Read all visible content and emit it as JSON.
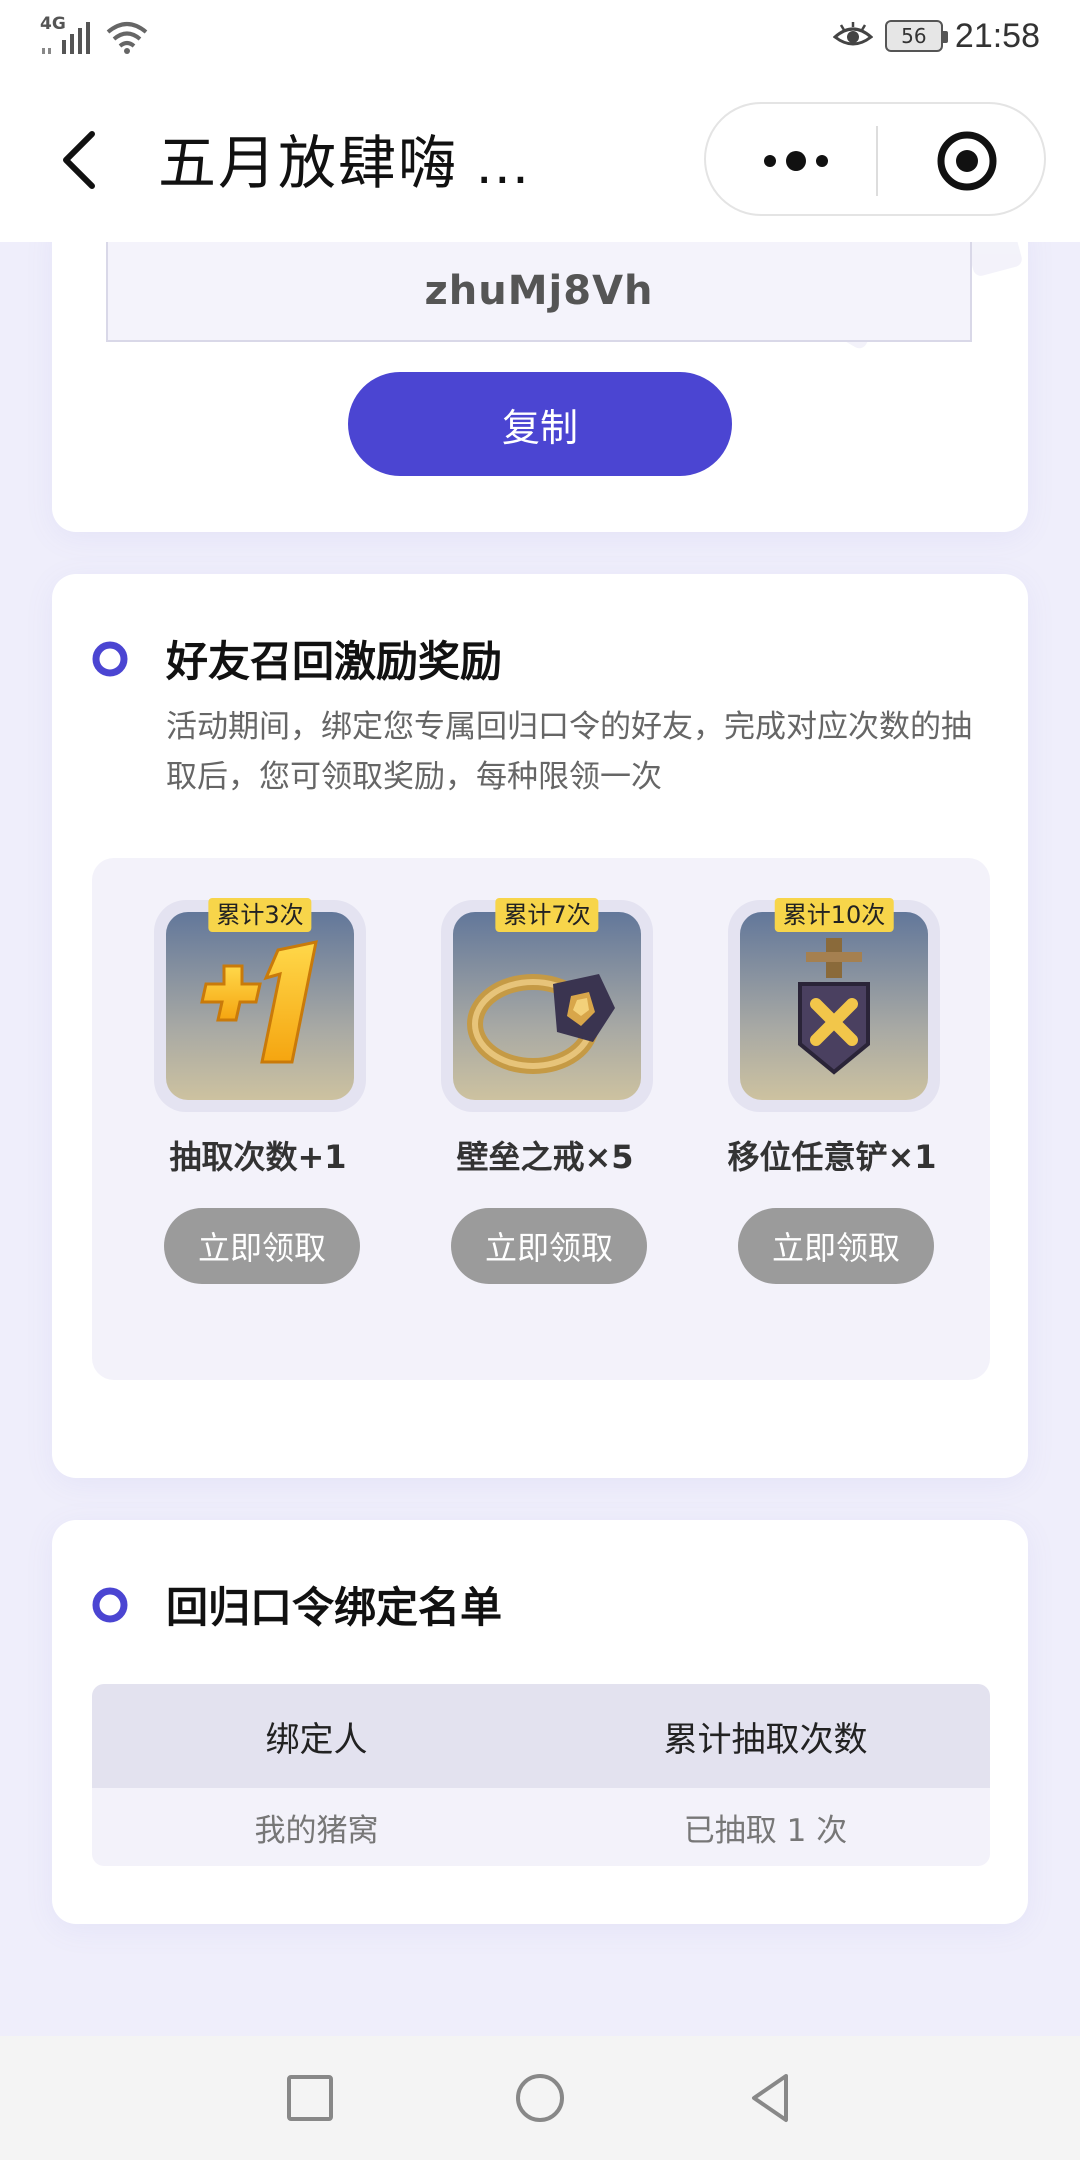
{
  "status_bar": {
    "network": "4G",
    "battery": "56",
    "time": "21:58"
  },
  "title_bar": {
    "title": "五月放肆嗨 ..."
  },
  "code_card": {
    "code": "zhuMj8Vh",
    "copy_label": "复制"
  },
  "reward_section": {
    "title": "好友召回激励奖励",
    "description": "活动期间，绑定您专属回归口令的好友，完成对应次数的抽取后，您可领取奖励，每种限领一次",
    "items": [
      {
        "badge": "累计3次",
        "name": "抽取次数+1",
        "button": "立即领取",
        "icon": "plus-one-icon"
      },
      {
        "badge": "累计7次",
        "name": "壁垒之戒×5",
        "button": "立即领取",
        "icon": "ring-icon"
      },
      {
        "badge": "累计10次",
        "name": "移位任意铲×1",
        "button": "立即领取",
        "icon": "shovel-medal-icon"
      }
    ]
  },
  "binding_section": {
    "title": "回归口令绑定名单",
    "headers": [
      "绑定人",
      "累计抽取次数"
    ],
    "rows": [
      [
        "我的猪窝",
        "已抽取 1 次"
      ]
    ]
  },
  "colors": {
    "accent": "#4b45d2",
    "badge": "#f7d54a",
    "disabled_button": "#9b9b9b",
    "page_background": "#efeefb"
  }
}
